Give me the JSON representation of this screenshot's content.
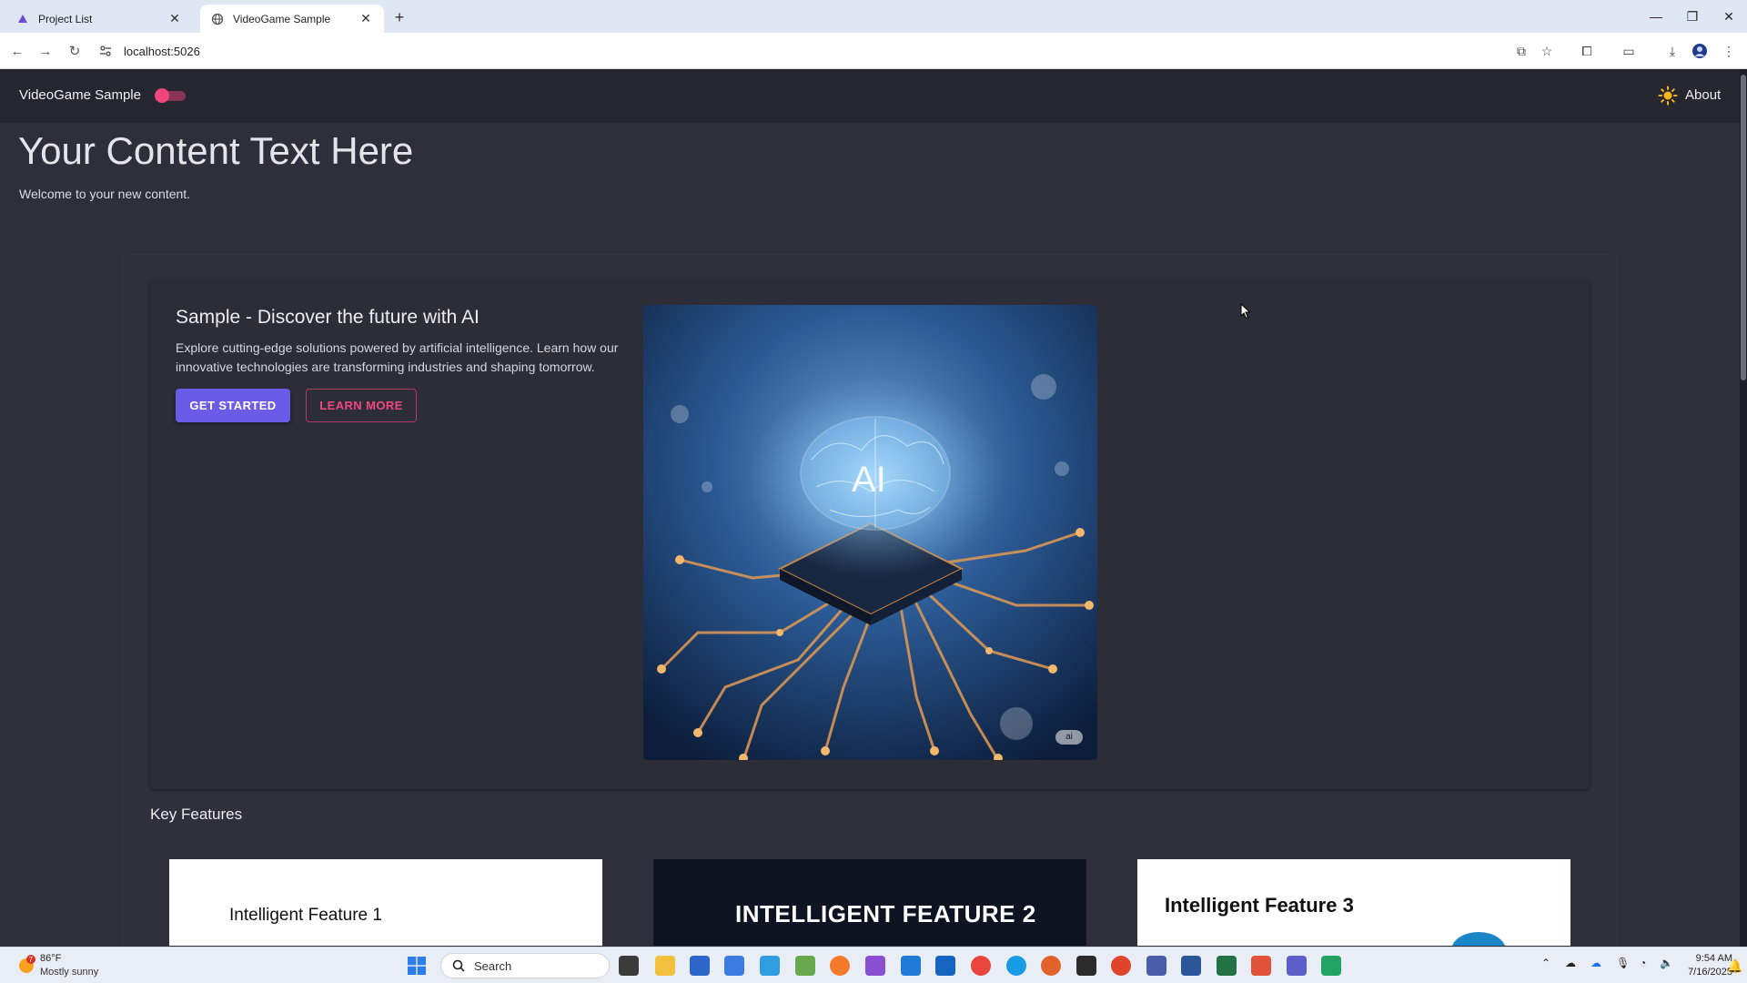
{
  "browser": {
    "tabs": [
      {
        "title": "Project List",
        "active": false
      },
      {
        "title": "VideoGame Sample",
        "active": true
      }
    ],
    "address": "localhost:5026"
  },
  "app": {
    "brand": "VideoGame Sample",
    "about_label": "About",
    "accent_color": "#f1477f",
    "primary_color": "#6b5ce7"
  },
  "page": {
    "heading": "Your Content Text Here",
    "welcome": "Welcome to your new content."
  },
  "hero": {
    "title": "Sample - Discover the future with AI",
    "description": "Explore cutting-edge solutions powered by artificial intelligence. Learn how our innovative technologies are transforming industries and shaping tomorrow.",
    "primary_button": "GET STARTED",
    "secondary_button": "LEARN MORE",
    "image_text": "AI",
    "image_badge": "ai"
  },
  "features": {
    "section_title": "Key Features",
    "items": [
      {
        "label": "Intelligent Feature 1"
      },
      {
        "label": "INTELLIGENT FEATURE 2"
      },
      {
        "label": "Intelligent Feature 3"
      }
    ]
  },
  "taskbar": {
    "weather_badge": "7",
    "weather_temp": "86°F",
    "weather_desc": "Mostly sunny",
    "search_label": "Search",
    "time": "9:54 AM",
    "date": "7/16/2025"
  }
}
